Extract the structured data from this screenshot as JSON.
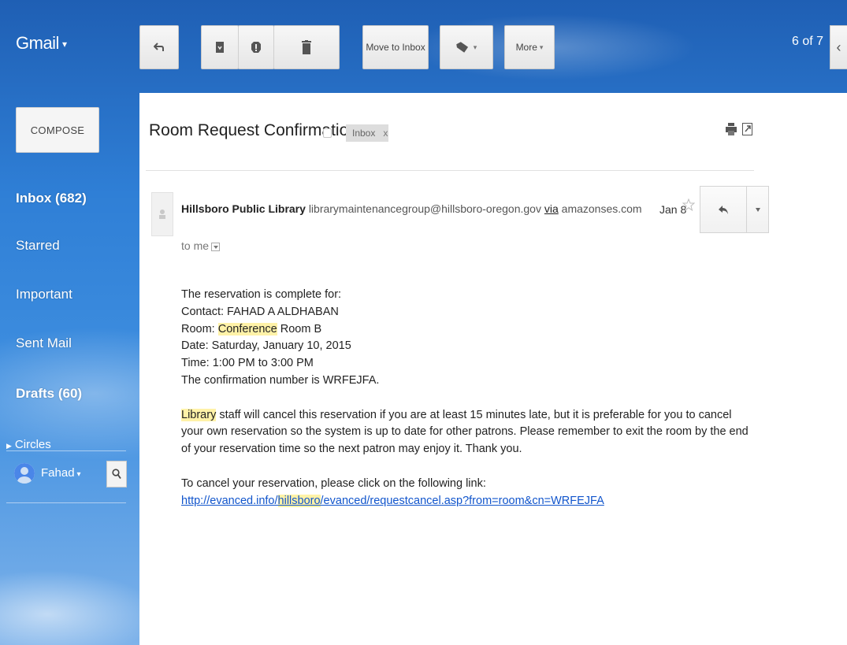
{
  "topbar": {
    "logo": "Gmail",
    "logo_caret": "▾",
    "move_to_inbox": "Move to Inbox",
    "more": "More",
    "more_caret": "▾",
    "pager": "6 of 7",
    "prev_glyph": "‹"
  },
  "leftnav": {
    "compose": "COMPOSE",
    "items": [
      {
        "label": "Inbox (682)",
        "bold": true
      },
      {
        "label": "Starred",
        "bold": false
      },
      {
        "label": "Important",
        "bold": false
      },
      {
        "label": "Sent Mail",
        "bold": false
      },
      {
        "label": "Drafts (60)",
        "bold": true
      }
    ],
    "circles": "Circles",
    "user": "Fahad",
    "user_caret": "▾"
  },
  "message": {
    "subject": "Room Request Confirmation",
    "label": "Inbox",
    "label_close": "x",
    "sender_name": "Hillsboro Public Library",
    "sender_email": "librarymaintenancegroup@hillsboro-oregon.gov",
    "via_word": "via",
    "via_domain": "amazonses.com",
    "to": "to me",
    "date": "Jan 8",
    "body": {
      "line1": "The reservation is complete for:",
      "line2": "Contact: FAHAD A ALDHABAN",
      "room_prefix": "Room: ",
      "room_highlight": "Conference",
      "room_suffix": " Room B",
      "line4": "Date: Saturday, January 10, 2015",
      "line5": "Time: 1:00 PM to 3:00 PM",
      "line6": "The confirmation number is WRFEJFA.",
      "para2_highlight": "Library",
      "para2_rest": " staff will cancel this reservation if you are at least 15 minutes late, but it is preferable for you to cancel your own reservation so the system is up to date for other patrons. Please remember to exit the room by the end of your reservation time so the next patron may enjoy it. Thank you.",
      "cancel_intro": "To cancel your reservation, please click on the following link:",
      "link_prefix": "http://evanced.info/",
      "link_highlight": "hillsboro",
      "link_suffix": "/evanced/requestcancel.asp?from=room&cn=WRFEJFA"
    }
  },
  "colors": {
    "link": "#1155cc",
    "highlight": "#fff2a8",
    "sky": "#2f7fd6"
  }
}
